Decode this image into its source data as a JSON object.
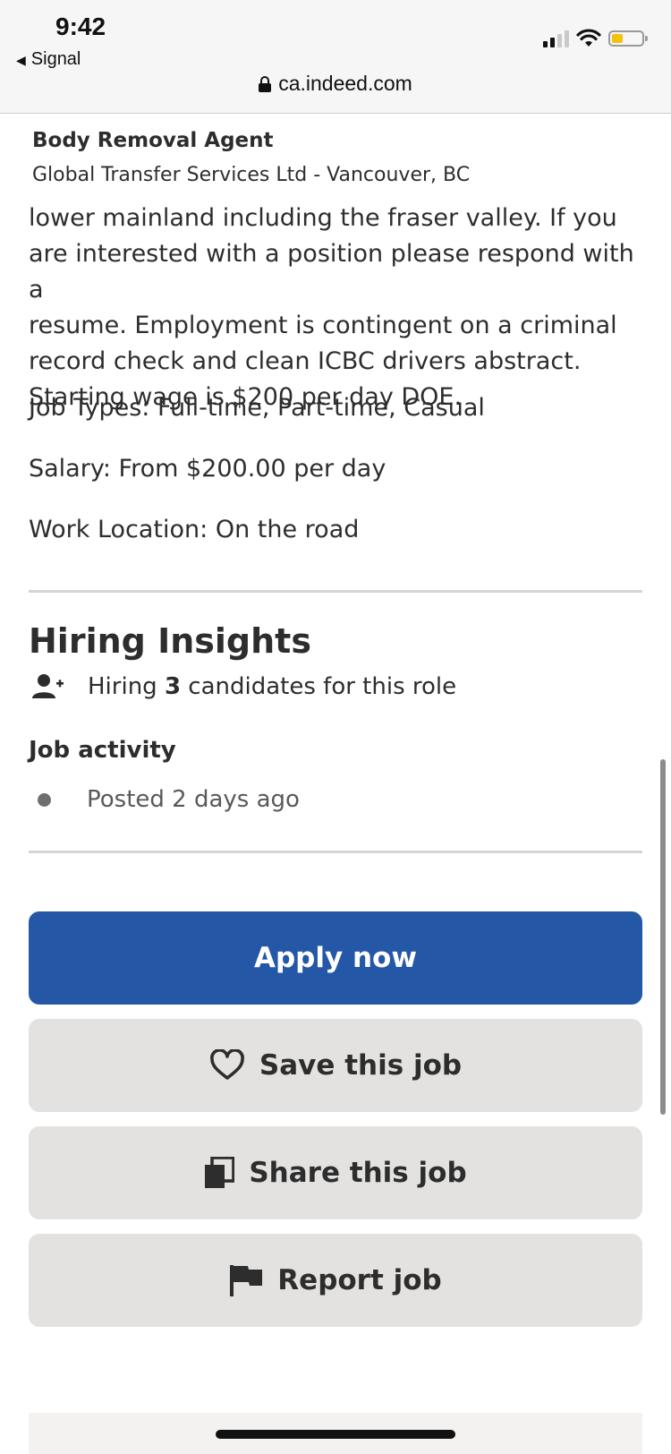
{
  "status_bar": {
    "time": "9:42",
    "back_app": "Signal",
    "back_arrow_icon": "triangle-left-icon",
    "url": "ca.indeed.com",
    "battery_color": "#f4c20d"
  },
  "job_header": {
    "title": "Body Removal Agent",
    "company": "Global Transfer Services Ltd - Vancouver, BC"
  },
  "description": {
    "lines": [
      "lower mainland including the fraser valley. If you",
      "are interested with a position please respond with a",
      "resume. Employment is contingent on a criminal",
      "record check and clean ICBC drivers abstract.",
      "Starting wage is $200 per day DOE."
    ],
    "job_types": "Job Types: Full-time, Part-time, Casual",
    "salary": "Salary: From $200.00 per day",
    "work_location": "Work Location: On the road"
  },
  "hiring_insights": {
    "heading": "Hiring Insights",
    "hiring_prefix": "Hiring ",
    "hiring_count": "3",
    "hiring_suffix": " candidates for this role",
    "activity_heading": "Job activity",
    "posted": "Posted 2 days ago"
  },
  "actions": {
    "apply": "Apply now",
    "save": "Save this job",
    "share": "Share this job",
    "report": "Report job"
  },
  "colors": {
    "primary": "#2557a7",
    "secondary_button": "#e4e2e0",
    "text": "#2d2d2d"
  }
}
